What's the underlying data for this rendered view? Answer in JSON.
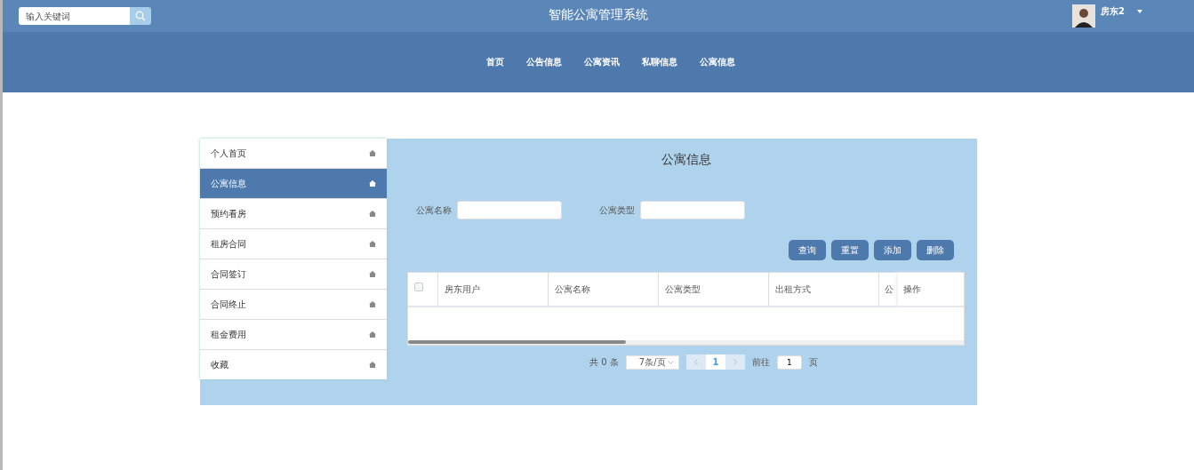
{
  "header": {
    "search": {
      "placeholder": "输入关键词"
    },
    "title": "智能公寓管理系统",
    "user": {
      "name": "房东2"
    }
  },
  "nav": [
    {
      "label": "首页"
    },
    {
      "label": "公告信息"
    },
    {
      "label": "公寓资讯"
    },
    {
      "label": "私聊信息"
    },
    {
      "label": "公寓信息"
    }
  ],
  "sidebar": {
    "items": [
      {
        "label": "个人首页",
        "selected": false
      },
      {
        "label": "公寓信息",
        "selected": true
      },
      {
        "label": "预约看房",
        "selected": false
      },
      {
        "label": "租房合同",
        "selected": false
      },
      {
        "label": "合同签订",
        "selected": false
      },
      {
        "label": "合同终止",
        "selected": false
      },
      {
        "label": "租金费用",
        "selected": false
      },
      {
        "label": "收藏",
        "selected": false
      }
    ]
  },
  "main": {
    "title": "公寓信息",
    "filters": [
      {
        "label": "公寓名称"
      },
      {
        "label": "公寓类型"
      }
    ],
    "buttons": [
      "查询",
      "重置",
      "添加",
      "删除"
    ],
    "table": {
      "select_all": {
        "checked": false
      },
      "columns": [
        "房东用户",
        "公寓名称",
        "公寓类型",
        "出租方式",
        "公"
      ],
      "fixed_column": "操作"
    },
    "pagination": {
      "total": "共 0 条",
      "page_size": "7条/页",
      "current_page": "1",
      "goto_label": "前往",
      "goto_value": "1",
      "page_suffix": "页"
    }
  }
}
